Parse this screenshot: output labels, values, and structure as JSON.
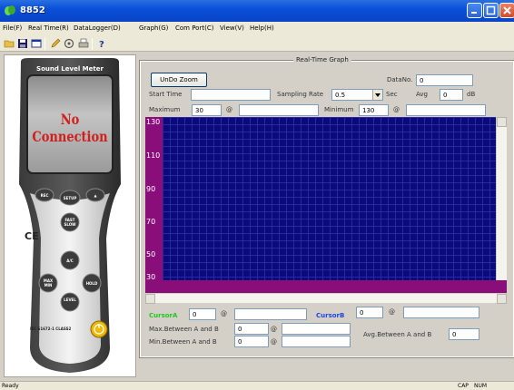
{
  "window": {
    "title": "8852"
  },
  "menu": [
    "File(F)",
    "Real Time(R)",
    "DataLogger(D)",
    "Graph(G)",
    "Com Port(C)",
    "View(V)",
    "Help(H)"
  ],
  "toolbar": {
    "icons": [
      "open-folder-icon",
      "save-disk-icon",
      "datalogger-icon",
      "pencil-icon",
      "settings-circle-icon",
      "print-icon",
      "help-icon"
    ]
  },
  "meter": {
    "title": "Sound Level Meter",
    "status": "No Connection",
    "buttons": {
      "rec": "REC",
      "setup": "SETUP",
      "up": "▲",
      "fast_slow": "FAST\nSLOW",
      "ac": "A/C",
      "max_min": "MAX\nMIN",
      "hold": "HOLD",
      "level": "LEVEL"
    },
    "ce_mark": "CE",
    "standard": "IEC 61672-1 CLASS2"
  },
  "graph": {
    "frame_title": "Real-Time Graph",
    "undo_zoom": "UnDo Zoom",
    "data_no_label": "DataNo.",
    "data_no": "0",
    "start_time_label": "Start Time",
    "start_time": "",
    "sampling_rate_label": "Sampling Rate",
    "sampling_rate": "0.5",
    "sec_label": "Sec",
    "avg_label": "Avg",
    "avg": "0",
    "db_label": "dB",
    "maximum_label": "Maximum",
    "maximum": "30",
    "max_at_label": "@",
    "max_at": "",
    "minimum_label": "Minimum",
    "minimum": "130",
    "min_at_label": "@",
    "min_at": "",
    "y_ticks": [
      "130",
      "110",
      "90",
      "70",
      "50",
      "30"
    ]
  },
  "cursors": {
    "a_label": "CursorA",
    "a_value": "0",
    "a_at_label": "@",
    "a_at": "",
    "b_label": "CursorB",
    "b_value": "0",
    "b_at_label": "@",
    "b_at": "",
    "max_between_label": "Max.Between A and B",
    "max_between": "0",
    "max_between_at_label": "@",
    "max_between_at": "",
    "min_between_label": "Min.Between A and B",
    "min_between": "0",
    "min_between_at_label": "@",
    "min_between_at": "",
    "avg_between_label": "Avg.Between A and B",
    "avg_between": "0"
  },
  "status": {
    "left": "Ready",
    "caps": "CAP",
    "num": "NUM"
  },
  "colors": {
    "plot_bg": "#0a0a78",
    "plot_axis": "#8a0e7a",
    "cursor_a": "#1ec81e",
    "cursor_b": "#1e46e6",
    "no_connection": "#d0201c"
  }
}
